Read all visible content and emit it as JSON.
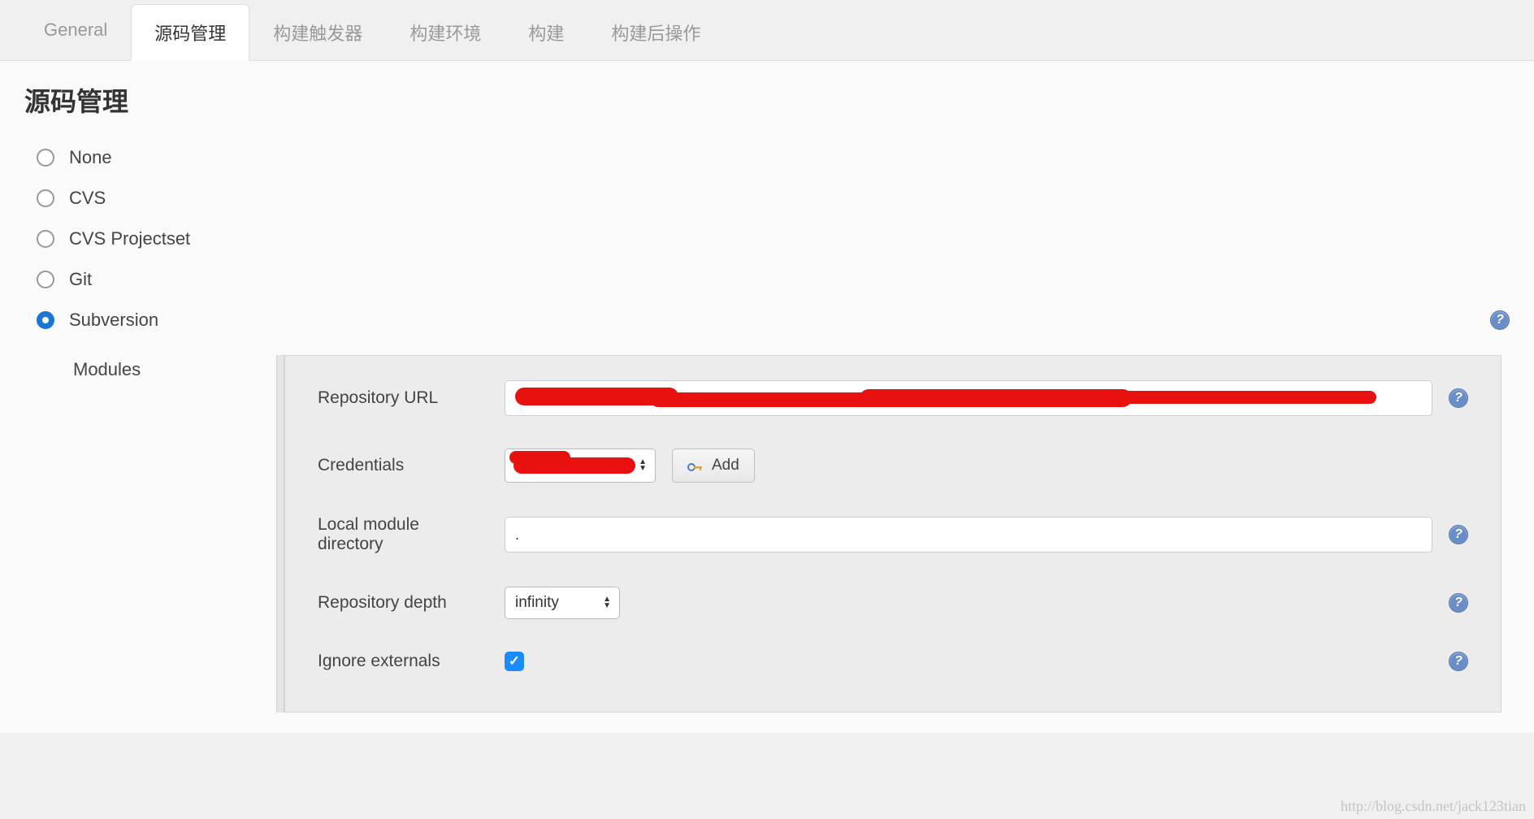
{
  "tabs": [
    {
      "label": "General",
      "active": false
    },
    {
      "label": "源码管理",
      "active": true
    },
    {
      "label": "构建触发器",
      "active": false
    },
    {
      "label": "构建环境",
      "active": false
    },
    {
      "label": "构建",
      "active": false
    },
    {
      "label": "构建后操作",
      "active": false
    }
  ],
  "section_title": "源码管理",
  "scm_options": [
    {
      "label": "None",
      "checked": false
    },
    {
      "label": "CVS",
      "checked": false
    },
    {
      "label": "CVS Projectset",
      "checked": false
    },
    {
      "label": "Git",
      "checked": false
    },
    {
      "label": "Subversion",
      "checked": true
    }
  ],
  "modules": {
    "label": "Modules",
    "fields": {
      "repo_url": {
        "label": "Repository URL",
        "value": ""
      },
      "credentials": {
        "label": "Credentials",
        "add_button": "Add"
      },
      "local_dir": {
        "label": "Local module directory",
        "value": "."
      },
      "repo_depth": {
        "label": "Repository depth",
        "value": "infinity"
      },
      "ignore_externals": {
        "label": "Ignore externals",
        "checked": true
      }
    }
  },
  "watermark": "http://blog.csdn.net/jack123tian"
}
